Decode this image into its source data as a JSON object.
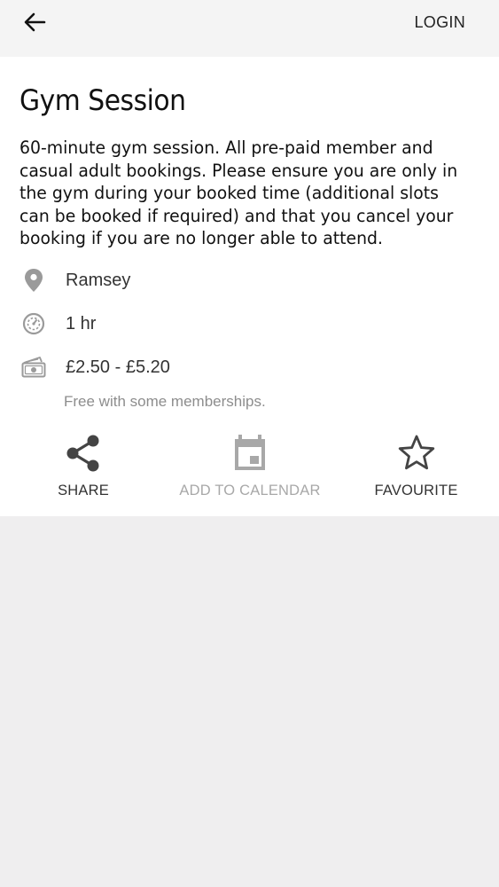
{
  "header": {
    "back_icon": "arrow-left-icon",
    "login_label": "LOGIN"
  },
  "session": {
    "title": "Gym Session",
    "description": "60-minute gym session. All pre-paid member and casual adult bookings. Please ensure you are only in the gym during your booked time (additional slots can be booked if required) and that you cancel your booking if you are no longer able to attend.",
    "location": "Ramsey",
    "duration": "1 hr",
    "price": "£2.50 - £5.20",
    "price_note": "Free with some memberships."
  },
  "actions": {
    "share_label": "SHARE",
    "calendar_label": "ADD TO CALENDAR",
    "favourite_label": "FAVOURITE"
  },
  "colors": {
    "topbar_bg": "#f4f4f4",
    "card_bg": "#ffffff",
    "page_bg": "#efeeef",
    "icon_gray": "#9a9a9a",
    "disabled_gray": "#a8a8a8",
    "action_dark": "#444444"
  }
}
